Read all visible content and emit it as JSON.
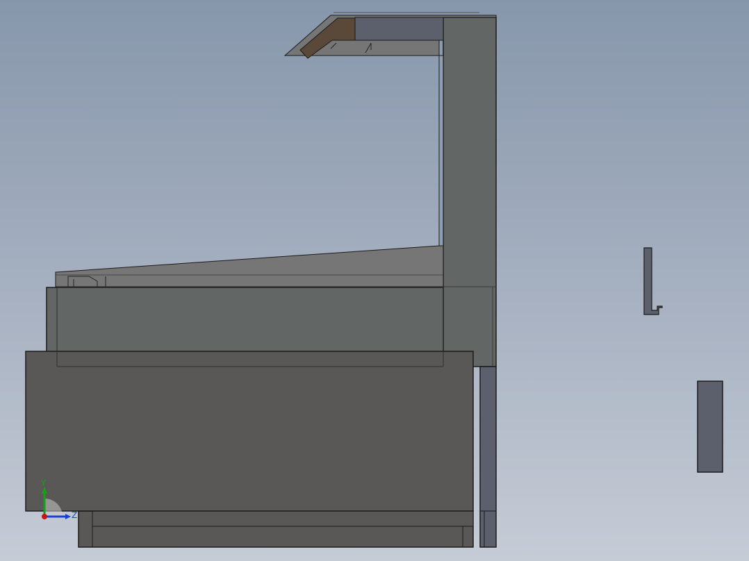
{
  "viewport": {
    "background_top": "#8797ab",
    "background_bottom": "#c6ccd6"
  },
  "model": {
    "colors": {
      "dark_body": "#595856",
      "panel_gray": "#626766",
      "light_gray": "#777676",
      "blue_gray": "#5c5f6c",
      "brown_trim": "#5a4838",
      "outline": "#1a1a1a"
    },
    "parts": [
      "case-base-drawer",
      "lower-body-panel",
      "counter-top",
      "rear-column",
      "top-canopy",
      "canopy-front-trim",
      "rear-leg",
      "floating-bracket",
      "floating-block"
    ]
  },
  "triad": {
    "y_label": "Y",
    "z_label": "Z",
    "y_color": "#16a016",
    "z_color": "#1a3ed6",
    "x_color": "#c81414"
  }
}
